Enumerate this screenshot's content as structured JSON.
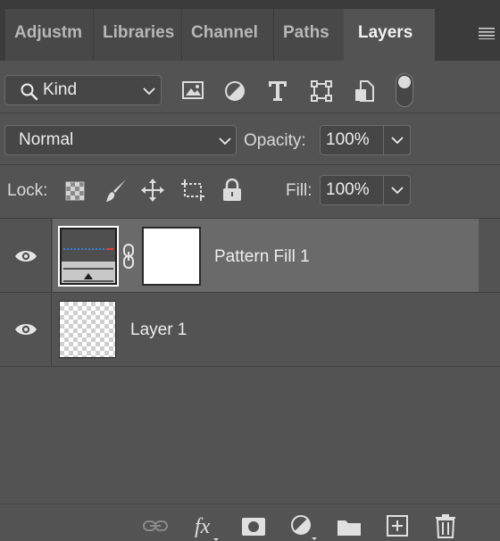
{
  "tabs": [
    {
      "label": "Adjustm",
      "active": false
    },
    {
      "label": "Libraries",
      "active": false
    },
    {
      "label": "Channel",
      "active": false
    },
    {
      "label": "Paths",
      "active": false
    },
    {
      "label": "Layers",
      "active": true
    }
  ],
  "filter": {
    "kind_label": "Kind",
    "filter_icons": [
      "image-filter-icon",
      "adjustment-filter-icon",
      "type-filter-icon",
      "shape-filter-icon",
      "smart-object-filter-icon",
      "filter-toggle-icon"
    ]
  },
  "blend": {
    "mode": "Normal",
    "opacity_label": "Opacity:",
    "opacity_value": "100%"
  },
  "lock": {
    "label": "Lock:",
    "icons": [
      "lock-transparent-pixels-icon",
      "lock-image-pixels-icon",
      "lock-position-icon",
      "lock-artboard-icon",
      "lock-all-icon"
    ],
    "fill_label": "Fill:",
    "fill_value": "100%"
  },
  "layers": [
    {
      "name": "Pattern Fill 1",
      "selected": true,
      "visible": true,
      "has_mask": true
    },
    {
      "name": "Layer 1",
      "selected": false,
      "visible": true,
      "has_mask": false
    }
  ],
  "bottom_icons": [
    "link-layers-icon",
    "fx-icon",
    "add-mask-icon",
    "new-adjustment-layer-icon",
    "new-group-icon",
    "new-layer-icon",
    "delete-layer-icon"
  ],
  "colors": {
    "panel_bg": "#535353",
    "selected_row": "#6a6a6a",
    "tab_bg": "#3b3b3b"
  }
}
